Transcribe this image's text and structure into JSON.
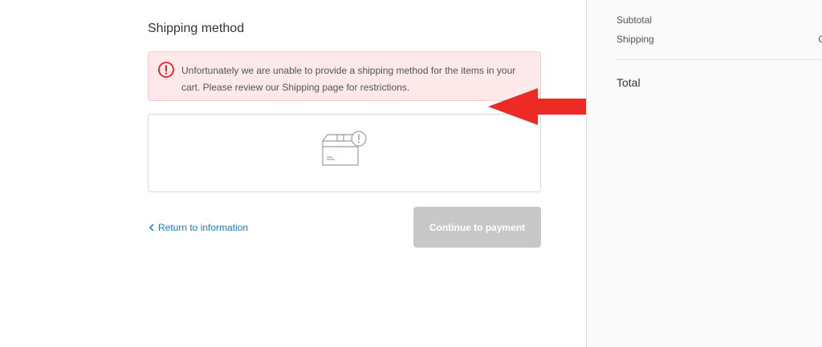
{
  "shipping": {
    "title": "Shipping method",
    "notice_text": "Unfortunately we are unable to provide a shipping method for the items in your cart. Please review our Shipping page for restrictions.",
    "empty_icon": "package-alert-icon"
  },
  "navigation": {
    "return_label": "Return to information",
    "continue_label": "Continue to payment"
  },
  "summary": {
    "subtotal_label": "Subtotal",
    "shipping_label": "Shipping",
    "shipping_value": "C",
    "total_label": "Total"
  },
  "colors": {
    "accent_link": "#197bbd",
    "error_icon": "#e22120",
    "notice_bg": "#fde9ea",
    "disabled_button": "#c8c8c8",
    "annotation_arrow": "#ee2a24"
  }
}
